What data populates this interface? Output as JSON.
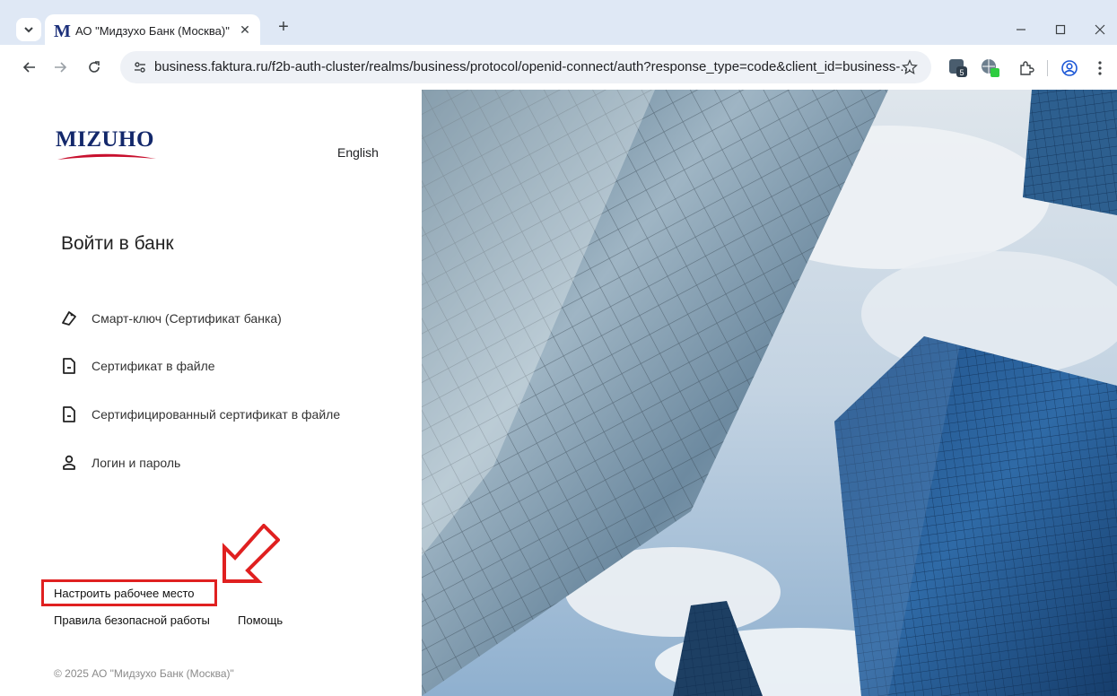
{
  "browser": {
    "tab_title": "АО \"Мидзухо Банк (Москва)\"",
    "tab_favicon": "M",
    "new_tab": "+",
    "close_tab": "✕",
    "url": "business.faktura.ru/f2b-auth-cluster/realms/business/protocol/openid-connect/auth?response_type=code&client_id=business-...",
    "extension_badge": "5"
  },
  "header": {
    "logo": "MIZUHO",
    "language": "English"
  },
  "login": {
    "title": "Войти в банк",
    "methods": [
      {
        "label": "Смарт-ключ (Сертификат банка)",
        "icon": "smart-key-icon"
      },
      {
        "label": "Сертификат в файле",
        "icon": "file-certificate-icon"
      },
      {
        "label": "Сертифицированный сертификат в файле",
        "icon": "file-certificate-icon"
      },
      {
        "label": "Логин и пароль",
        "icon": "user-icon"
      }
    ]
  },
  "footer": {
    "setup": "Настроить рабочее место",
    "rules": "Правила безопасной работы",
    "help": "Помощь",
    "copyright": "© 2025 АО \"Мидзухо Банк (Москва)\""
  },
  "colors": {
    "highlight": "#e02020",
    "logo": "#13286b"
  }
}
